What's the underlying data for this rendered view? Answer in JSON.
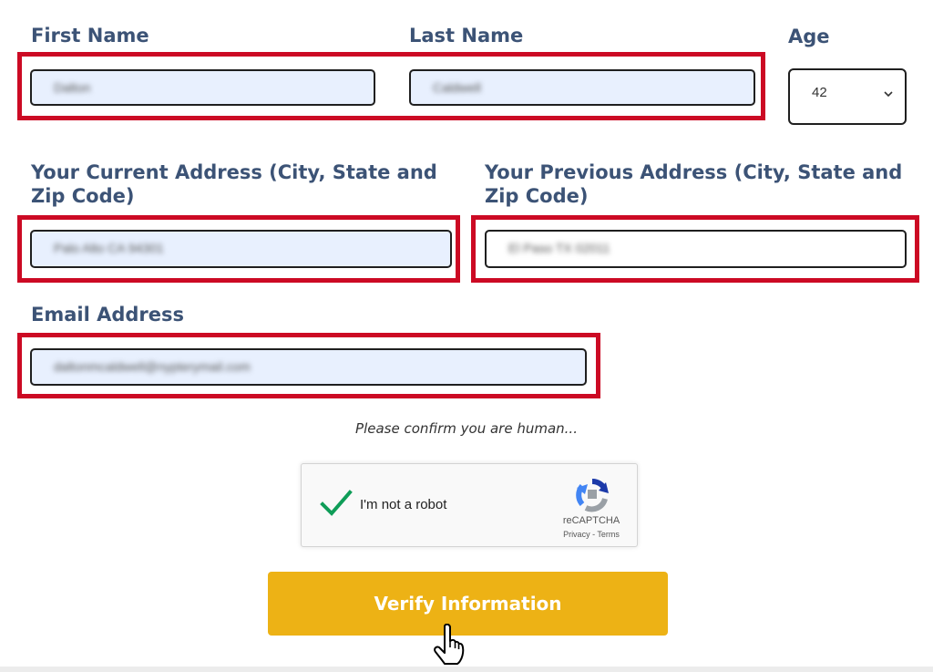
{
  "form": {
    "first_name": {
      "label": "First Name",
      "value": "Dalton"
    },
    "last_name": {
      "label": "Last Name",
      "value": "Caldwell"
    },
    "age": {
      "label": "Age",
      "value": "42"
    },
    "current_address": {
      "label": "Your Current Address (City, State and Zip Code)",
      "value": "Palo Alto CA 94301"
    },
    "previous_address": {
      "label": "Your Previous Address (City, State and Zip Code)",
      "value": "El Paso TX 02011"
    },
    "email": {
      "label": "Email Address",
      "value": "daltonmcaldwell@nypterymail.com"
    }
  },
  "captcha": {
    "prompt": "Please confirm you are human...",
    "checkbox_label": "I'm not a robot",
    "checked": true,
    "brand": "reCAPTCHA",
    "privacy": "Privacy",
    "separator": " - ",
    "terms": "Terms"
  },
  "submit_label": "Verify Information",
  "colors": {
    "label": "#3c5376",
    "highlight": "#cc0a24",
    "button": "#edb215",
    "check": "#0f9d58",
    "autofill_bg": "#e8f0fe"
  }
}
